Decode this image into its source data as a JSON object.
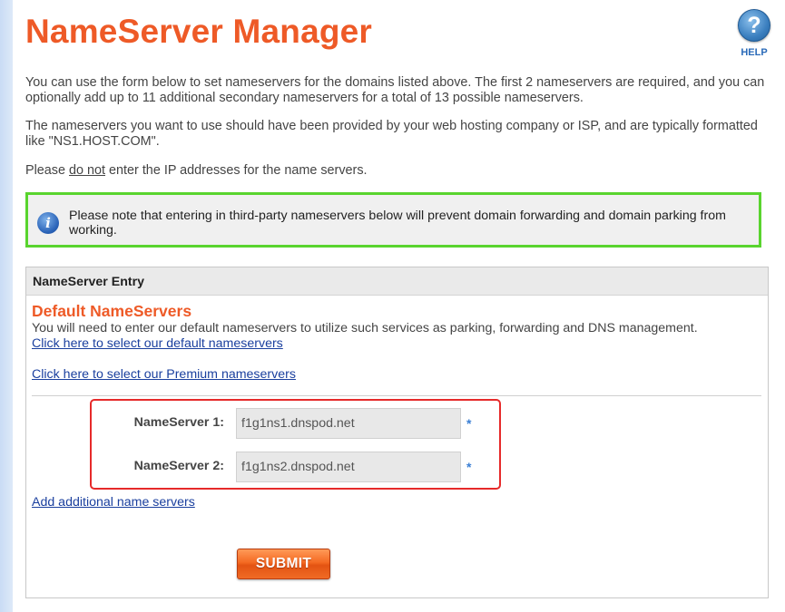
{
  "page": {
    "title": "NameServer Manager",
    "help_label": "HELP",
    "help_icon_glyph": "?",
    "paragraph1": "You can use the form below to set nameservers for the domains listed above. The first 2 nameservers are required, and you can optionally add up to 11 additional secondary nameservers for a total of 13 possible nameservers.",
    "paragraph2": "The nameservers you want to use should have been provided by your web hosting company or ISP, and are typically formatted like \"NS1.HOST.COM\".",
    "paragraph3_prefix": "Please ",
    "paragraph3_emphasis": "do not",
    "paragraph3_suffix": " enter the IP addresses for the name servers."
  },
  "notice": {
    "icon": "info-icon",
    "icon_glyph": "i",
    "text": "Please note that entering in third-party nameservers below will prevent domain forwarding and domain parking from working.",
    "border_color": "#59d42e"
  },
  "panel": {
    "header": "NameServer Entry",
    "default_title": "Default NameServers",
    "default_desc": "You will need to enter our default nameservers to utilize such services as parking, forwarding and DNS management.",
    "default_link": "Click here to select our default nameservers",
    "premium_link": "Click here to select our Premium nameservers",
    "add_link": "Add additional name servers",
    "submit_label": "SUBMIT",
    "required_marker": "*"
  },
  "nameservers": [
    {
      "label": "NameServer 1:",
      "value": "f1g1ns1.dnspod.net"
    },
    {
      "label": "NameServer 2:",
      "value": "f1g1ns2.dnspod.net"
    }
  ],
  "colors": {
    "title": "#ee5a27",
    "link": "#1a3f9e",
    "highlight_box": "#e62a2a",
    "submit": "#f46a22"
  }
}
